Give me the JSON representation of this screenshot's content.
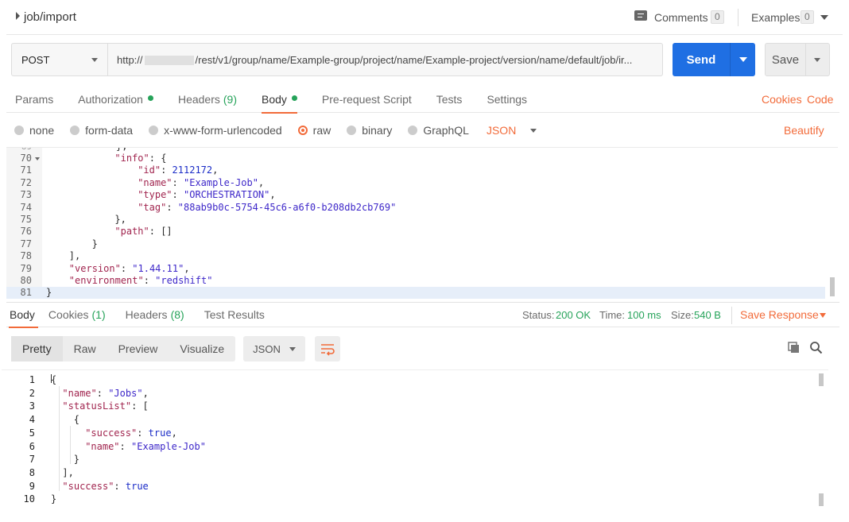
{
  "header": {
    "title": "job/import",
    "comments_label": "Comments",
    "comments_count": "0",
    "examples_label": "Examples",
    "examples_count": "0"
  },
  "request": {
    "method": "POST",
    "url_prefix": "http://",
    "url_suffix": "/rest/v1/group/name/Example-group/project/name/Example-project/version/name/default/job/ir...",
    "send_label": "Send",
    "save_label": "Save"
  },
  "tabs": [
    {
      "label": "Params"
    },
    {
      "label": "Authorization",
      "dot": true
    },
    {
      "label": "Headers",
      "count": "(9)"
    },
    {
      "label": "Body",
      "dot": true,
      "active": true
    },
    {
      "label": "Pre-request Script"
    },
    {
      "label": "Tests"
    },
    {
      "label": "Settings"
    }
  ],
  "tabs_right": {
    "cookies": "Cookies",
    "code": "Code"
  },
  "body_types": [
    {
      "label": "none"
    },
    {
      "label": "form-data"
    },
    {
      "label": "x-www-form-urlencoded"
    },
    {
      "label": "raw",
      "selected": true
    },
    {
      "label": "binary"
    },
    {
      "label": "GraphQL"
    }
  ],
  "format_select": "JSON",
  "beautify_label": "Beautify",
  "editor_lines": [
    {
      "n": "70",
      "fold": true,
      "indent": 12,
      "parts": [
        [
          "k",
          "\"info\""
        ],
        [
          "b",
          ": {"
        ]
      ]
    },
    {
      "n": "71",
      "indent": 16,
      "parts": [
        [
          "k",
          "\"id\""
        ],
        [
          "b",
          ": "
        ],
        [
          "n",
          "2112172"
        ],
        [
          "b",
          ","
        ]
      ]
    },
    {
      "n": "72",
      "indent": 16,
      "parts": [
        [
          "k",
          "\"name\""
        ],
        [
          "b",
          ": "
        ],
        [
          "s",
          "\"Example-Job\""
        ],
        [
          "b",
          ","
        ]
      ]
    },
    {
      "n": "73",
      "indent": 16,
      "parts": [
        [
          "k",
          "\"type\""
        ],
        [
          "b",
          ": "
        ],
        [
          "s",
          "\"ORCHESTRATION\""
        ],
        [
          "b",
          ","
        ]
      ]
    },
    {
      "n": "74",
      "indent": 16,
      "parts": [
        [
          "k",
          "\"tag\""
        ],
        [
          "b",
          ": "
        ],
        [
          "s",
          "\"88ab9b0c-5754-45c6-a6f0-b208db2cb769\""
        ]
      ]
    },
    {
      "n": "75",
      "indent": 12,
      "parts": [
        [
          "b",
          "},"
        ]
      ]
    },
    {
      "n": "76",
      "indent": 12,
      "parts": [
        [
          "k",
          "\"path\""
        ],
        [
          "b",
          ": []"
        ]
      ]
    },
    {
      "n": "77",
      "indent": 8,
      "parts": [
        [
          "b",
          "}"
        ]
      ]
    },
    {
      "n": "78",
      "indent": 4,
      "parts": [
        [
          "b",
          "],"
        ]
      ]
    },
    {
      "n": "79",
      "indent": 4,
      "parts": [
        [
          "k",
          "\"version\""
        ],
        [
          "b",
          ": "
        ],
        [
          "s",
          "\"1.44.11\""
        ],
        [
          "b",
          ","
        ]
      ]
    },
    {
      "n": "80",
      "indent": 4,
      "parts": [
        [
          "k",
          "\"environment\""
        ],
        [
          "b",
          ": "
        ],
        [
          "s",
          "\"redshift\""
        ]
      ]
    },
    {
      "n": "81",
      "indent": 0,
      "active": true,
      "parts": [
        [
          "b",
          "}"
        ]
      ]
    }
  ],
  "response": {
    "tabs": [
      {
        "label": "Body",
        "active": true
      },
      {
        "label": "Cookies",
        "count": "(1)"
      },
      {
        "label": "Headers",
        "count": "(8)"
      },
      {
        "label": "Test Results"
      }
    ],
    "status_label": "Status:",
    "status_value": "200 OK",
    "time_label": "Time:",
    "time_value": "100 ms",
    "size_label": "Size:",
    "size_value": "540 B",
    "save_response_label": "Save Response",
    "view_modes": [
      {
        "label": "Pretty",
        "active": true
      },
      {
        "label": "Raw"
      },
      {
        "label": "Preview"
      },
      {
        "label": "Visualize"
      }
    ],
    "format_select": "JSON",
    "lines": [
      {
        "n": "1",
        "indent": 0,
        "parts": [
          [
            "b",
            "{"
          ]
        ]
      },
      {
        "n": "2",
        "indent": 2,
        "parts": [
          [
            "k",
            "\"name\""
          ],
          [
            "b",
            ": "
          ],
          [
            "s",
            "\"Jobs\""
          ],
          [
            "b",
            ","
          ]
        ]
      },
      {
        "n": "3",
        "indent": 2,
        "parts": [
          [
            "k",
            "\"statusList\""
          ],
          [
            "b",
            ": ["
          ]
        ]
      },
      {
        "n": "4",
        "indent": 4,
        "parts": [
          [
            "b",
            "{"
          ]
        ]
      },
      {
        "n": "5",
        "indent": 6,
        "parts": [
          [
            "k",
            "\"success\""
          ],
          [
            "b",
            ": "
          ],
          [
            "n",
            "true"
          ],
          [
            "b",
            ","
          ]
        ]
      },
      {
        "n": "6",
        "indent": 6,
        "parts": [
          [
            "k",
            "\"name\""
          ],
          [
            "b",
            ": "
          ],
          [
            "s",
            "\"Example-Job\""
          ]
        ]
      },
      {
        "n": "7",
        "indent": 4,
        "parts": [
          [
            "b",
            "}"
          ]
        ]
      },
      {
        "n": "8",
        "indent": 2,
        "parts": [
          [
            "b",
            "],"
          ]
        ]
      },
      {
        "n": "9",
        "indent": 2,
        "parts": [
          [
            "k",
            "\"success\""
          ],
          [
            "b",
            ": "
          ],
          [
            "n",
            "true"
          ]
        ]
      },
      {
        "n": "10",
        "indent": 0,
        "parts": [
          [
            "b",
            "}"
          ]
        ]
      }
    ]
  }
}
